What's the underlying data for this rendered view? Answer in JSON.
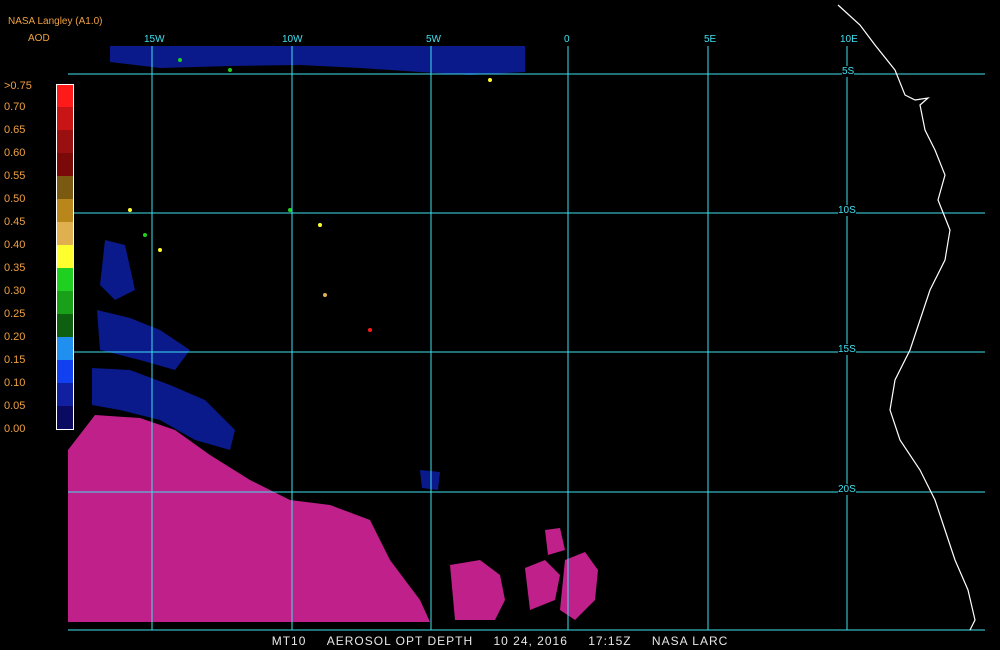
{
  "header": {
    "source": "NASA Langley (A1.0)",
    "product": "AOD"
  },
  "legend": {
    "labels": [
      ">0.75",
      "0.70",
      "0.65",
      "0.60",
      "0.55",
      "0.50",
      "0.45",
      "0.40",
      "0.35",
      "0.30",
      "0.25",
      "0.20",
      "0.15",
      "0.10",
      "0.05",
      "0.00"
    ],
    "colors": [
      "#ff1a1a",
      "#c81414",
      "#9a0f0f",
      "#7a0a0a",
      "#7a5a10",
      "#b8861a",
      "#e0b050",
      "#ffff30",
      "#20d020",
      "#18a018",
      "#0e6010",
      "#2090f0",
      "#1040f0",
      "#1020a0",
      "#0a0a60",
      "#c0208a"
    ]
  },
  "grid": {
    "lon_labels": [
      "15W",
      "10W",
      "5W",
      "0",
      "5E",
      "10E"
    ],
    "lat_labels": [
      "5S",
      "10S",
      "15S",
      "20S"
    ],
    "grid_color": "#40e0f0"
  },
  "caption": {
    "product": "MT10",
    "title": "AEROSOL OPT DEPTH",
    "date": "10 24, 2016",
    "time": "17:15Z",
    "credit": "NASA LARC"
  },
  "colors": {
    "background": "#000000",
    "coast": "#ffffff",
    "low_aod": "#c0208a",
    "mid_aod": "#0a1a8a"
  }
}
